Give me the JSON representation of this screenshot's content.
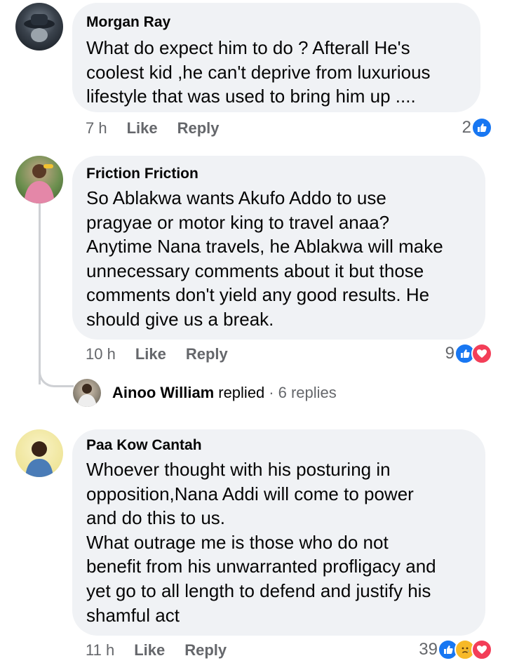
{
  "comments": [
    {
      "author": "Morgan Ray",
      "text": "What do expect him to do ? Afterall He's\ncoolest kid ,he can't deprive from luxurious\nlifestyle that was used to bring him up ....",
      "time": "7 h",
      "like_label": "Like",
      "reply_label": "Reply",
      "reaction_count": "2"
    },
    {
      "author": "Friction Friction",
      "text": "So Ablakwa wants Akufo Addo to use\npragyae or motor king to travel anaa?\nAnytime Nana travels, he Ablakwa will make\nunnecessary comments about it but those\ncomments don't yield any good results. He\nshould give us a break.",
      "time": "10 h",
      "like_label": "Like",
      "reply_label": "Reply",
      "reaction_count": "9"
    },
    {
      "author": "Paa Kow Cantah",
      "text": "Whoever thought with his posturing in\nopposition,Nana Addi will come to power\nand do this to us.\nWhat outrage me is those who do not\nbenefit from his unwarranted profligacy and\nyet go to all length to defend and justify his\nshamful act",
      "time": "11 h",
      "like_label": "Like",
      "reply_label": "Reply",
      "reaction_count": "39"
    }
  ],
  "reply_summary": {
    "name": "Ainoo William",
    "verb": "replied",
    "separator": "·",
    "count": "6 replies"
  },
  "colors": {
    "bubble": "#f0f2f5",
    "muted": "#65676b",
    "like": "#1877f2",
    "love": "#f33e58",
    "sad": "#f7b928"
  }
}
